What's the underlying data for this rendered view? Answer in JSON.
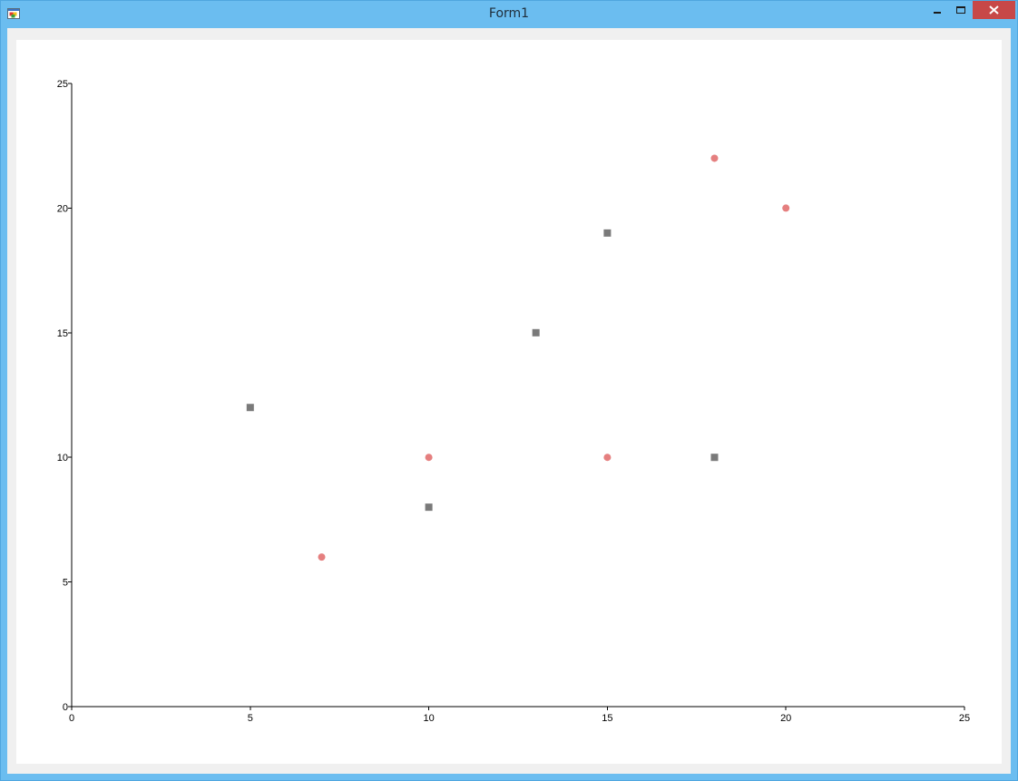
{
  "window": {
    "title": "Form1"
  },
  "colors": {
    "titlebar": "#6bbdf0",
    "close_button": "#c74848",
    "series_circle": "#e57f7f",
    "series_square": "#7a7a7a"
  },
  "icons": {
    "app": "form-app-icon",
    "minimize": "minimize-icon",
    "maximize": "maximize-icon",
    "close": "close-icon"
  },
  "chart_data": {
    "type": "scatter",
    "title": "",
    "xlabel": "",
    "ylabel": "",
    "xlim": [
      0,
      25
    ],
    "ylim": [
      0,
      25
    ],
    "xticks": [
      "0",
      "5",
      "10",
      "15",
      "20",
      "25"
    ],
    "yticks": [
      "0",
      "5",
      "10",
      "15",
      "20",
      "25"
    ],
    "grid": false,
    "series": [
      {
        "marker": "circle",
        "color": "#e57f7f",
        "points": [
          [
            7,
            6
          ],
          [
            10,
            10
          ],
          [
            15,
            10
          ],
          [
            18,
            22
          ],
          [
            20,
            20
          ]
        ]
      },
      {
        "marker": "square",
        "color": "#7a7a7a",
        "points": [
          [
            5,
            12
          ],
          [
            10,
            8
          ],
          [
            13,
            15
          ],
          [
            15,
            19
          ],
          [
            18,
            10
          ]
        ]
      }
    ]
  }
}
